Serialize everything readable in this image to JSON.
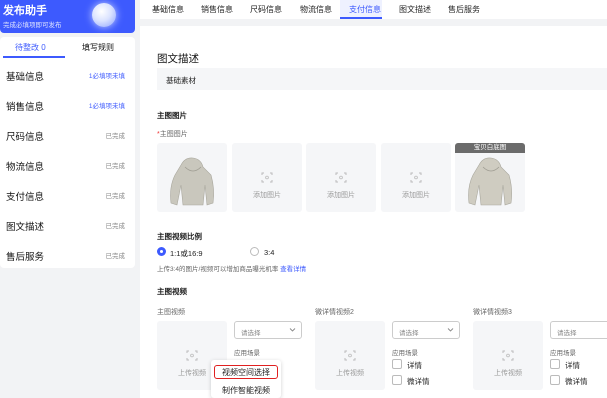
{
  "sidebar": {
    "title": "发布助手",
    "subtitle": "完成必填项即可发布",
    "tabs": [
      {
        "label": "待整改 0",
        "active": true
      },
      {
        "label": "填写规则",
        "active": false
      }
    ],
    "items": [
      {
        "label": "基础信息",
        "status": "1必填项未填",
        "warn": true
      },
      {
        "label": "销售信息",
        "status": "1必填项未填",
        "warn": true
      },
      {
        "label": "尺码信息",
        "status": "已完成",
        "warn": false
      },
      {
        "label": "物流信息",
        "status": "已完成",
        "warn": false
      },
      {
        "label": "支付信息",
        "status": "已完成",
        "warn": false
      },
      {
        "label": "图文描述",
        "status": "已完成",
        "warn": false
      },
      {
        "label": "售后服务",
        "status": "已完成",
        "warn": false
      }
    ]
  },
  "topnav": {
    "tabs": [
      "基础信息",
      "销售信息",
      "尺码信息",
      "物流信息",
      "支付信息",
      "图文描述",
      "售后服务"
    ],
    "active": "支付信息"
  },
  "main": {
    "section_title": "图文描述",
    "sub_section": "基础素材",
    "main_images": {
      "heading": "主图图片",
      "required_mark": "*",
      "label": "主图图片",
      "add_label": "添加图片",
      "badge": "宝贝白底图"
    },
    "video_ratio": {
      "heading": "主图视频比例",
      "options": [
        {
          "label": "1:1或16:9",
          "selected": true
        },
        {
          "label": "3:4",
          "selected": false
        }
      ],
      "hint": "上传3:4的图片/视频可以增加商品曝光机率",
      "hint_link": "查看详情"
    },
    "videos": {
      "heading": "主图视频",
      "columns": [
        {
          "label": "主图视频",
          "upload_label": "上传视频",
          "select_placeholder": "请选择",
          "scene_label": "应用场景",
          "options": []
        },
        {
          "label": "微详情视频2",
          "upload_label": "上传视频",
          "select_placeholder": "请选择",
          "scene_label": "应用场景",
          "options": [
            "详情",
            "微详情"
          ]
        },
        {
          "label": "微详情视频3",
          "upload_label": "上传视频",
          "select_placeholder": "请选择",
          "scene_label": "应用场景",
          "options": [
            "详情",
            "微详情"
          ]
        }
      ]
    },
    "popup_menu": {
      "items": [
        "视频空间选择",
        "制作智能视频"
      ],
      "selected": "视频空间选择"
    }
  },
  "colors": {
    "accent": "#3d5afe",
    "highlight_border": "#e02020"
  }
}
